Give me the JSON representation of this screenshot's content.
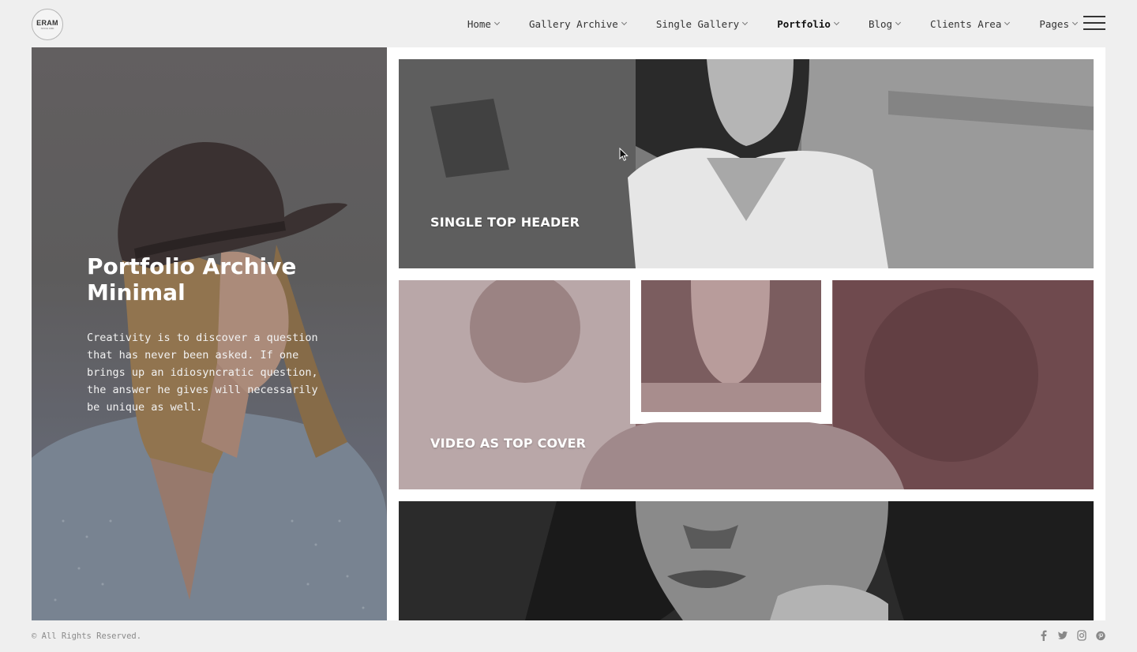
{
  "header": {
    "logo": {
      "text": "ERAM",
      "sub": "SINCE 1980"
    },
    "nav": [
      {
        "label": "Home"
      },
      {
        "label": "Gallery Archive"
      },
      {
        "label": "Single Gallery"
      },
      {
        "label": "Portfolio",
        "active": true
      },
      {
        "label": "Blog"
      },
      {
        "label": "Clients Area"
      },
      {
        "label": "Pages"
      }
    ],
    "menu_icon": "hamburger-icon"
  },
  "hero": {
    "title": "Portfolio Archive Minimal",
    "text": "Creativity is to discover a question that has never been asked. If one brings up an idiosyncratic question, the answer he gives will necessarily be unique as well."
  },
  "gallery": {
    "items": [
      {
        "label": "SINGLE TOP HEADER"
      },
      {
        "label": "VIDEO AS TOP COVER"
      },
      {
        "label": ""
      }
    ]
  },
  "footer": {
    "copyright": "© All Rights Reserved.",
    "social": [
      "facebook-icon",
      "twitter-icon",
      "instagram-icon",
      "pinterest-icon"
    ]
  }
}
